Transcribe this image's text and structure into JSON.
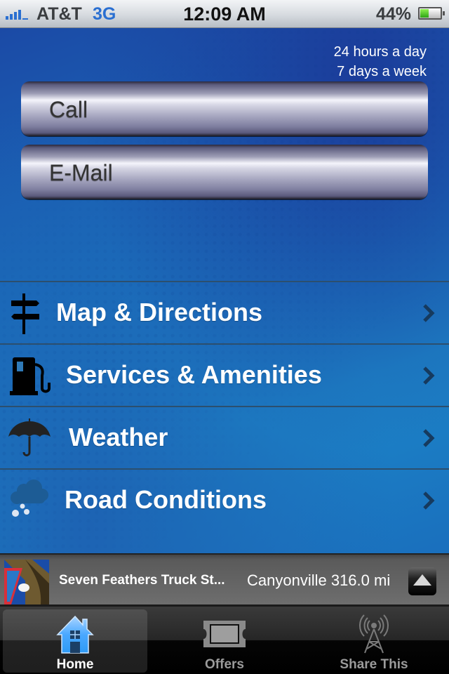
{
  "status_bar": {
    "carrier": "AT&T",
    "network": "3G",
    "time": "12:09 AM",
    "battery_percent": "44%",
    "battery_level": 0.44,
    "signal_bars": 4
  },
  "contact": {
    "hours_line1": "24 hours a day",
    "hours_line2": "7 days a week",
    "call_label": "Call",
    "email_label": "E-Mail"
  },
  "menu": {
    "items": [
      {
        "label": "Map & Directions",
        "icon": "signpost-icon"
      },
      {
        "label": "Services & Amenities",
        "icon": "fuel-pump-icon"
      },
      {
        "label": "Weather",
        "icon": "umbrella-icon"
      },
      {
        "label": "Road Conditions",
        "icon": "snow-cloud-icon"
      }
    ]
  },
  "location_bar": {
    "name": "Seven Feathers Truck St...",
    "city_distance": "Canyonville 316.0 mi",
    "toggle_icon": "expand-up-icon"
  },
  "tab_bar": {
    "tabs": [
      {
        "label": "Home",
        "icon": "home-icon",
        "active": true
      },
      {
        "label": "Offers",
        "icon": "ticket-icon",
        "active": false
      },
      {
        "label": "Share This",
        "icon": "broadcast-tower-icon",
        "active": false
      }
    ]
  },
  "colors": {
    "accent_blue": "#1a70bd",
    "network_blue": "#2a6fd1",
    "chevron": "#163a5e"
  }
}
